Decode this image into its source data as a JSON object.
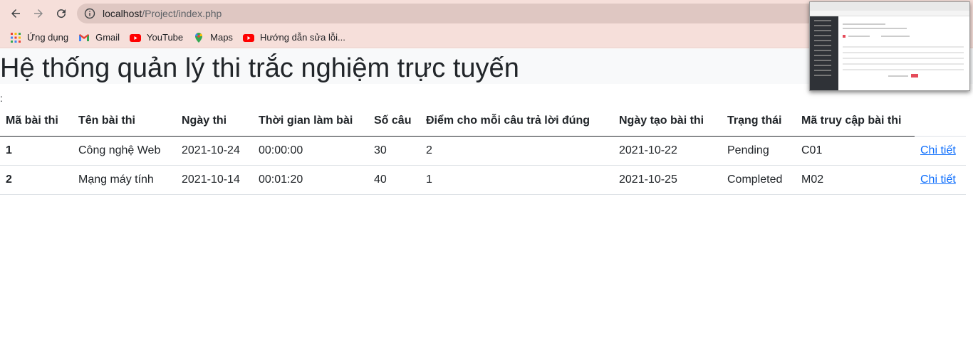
{
  "browser": {
    "url_host": "localhost",
    "url_path": "/Project/index.php",
    "bookmarks": [
      {
        "label": "Ứng dụng",
        "icon": "apps-grid-icon"
      },
      {
        "label": "Gmail",
        "icon": "gmail-icon"
      },
      {
        "label": "YouTube",
        "icon": "youtube-icon"
      },
      {
        "label": "Maps",
        "icon": "maps-icon"
      },
      {
        "label": "Hướng dẫn sửa lỗi...",
        "icon": "youtube-icon"
      }
    ]
  },
  "page": {
    "title": "Hệ thống quản lý thi trắc nghiệm trực tuyến",
    "prefix": ":"
  },
  "table": {
    "headers": [
      "Mã bài thi",
      "Tên bài thi",
      "Ngày thi",
      "Thời gian làm bài",
      "Số câu",
      "Điểm cho mỗi câu trả lời đúng",
      "Ngày tạo bài thi",
      "Trạng thái",
      "Mã truy cập bài thi"
    ],
    "rows": [
      {
        "id": "1",
        "name": "Công nghệ Web",
        "date": "2021-10-24",
        "duration": "00:00:00",
        "questions": "30",
        "points": "2",
        "created": "2021-10-22",
        "status": "Pending",
        "code": "C01",
        "action": "Chi tiết"
      },
      {
        "id": "2",
        "name": "Mạng máy tính",
        "date": "2021-10-14",
        "duration": "00:01:20",
        "questions": "40",
        "points": "1",
        "created": "2021-10-25",
        "status": "Completed",
        "code": "M02",
        "action": "Chi tiết"
      }
    ]
  },
  "colors": {
    "browser_bg": "#f6dfda",
    "link": "#0d6efd",
    "header_bg": "#f8f9fa"
  }
}
